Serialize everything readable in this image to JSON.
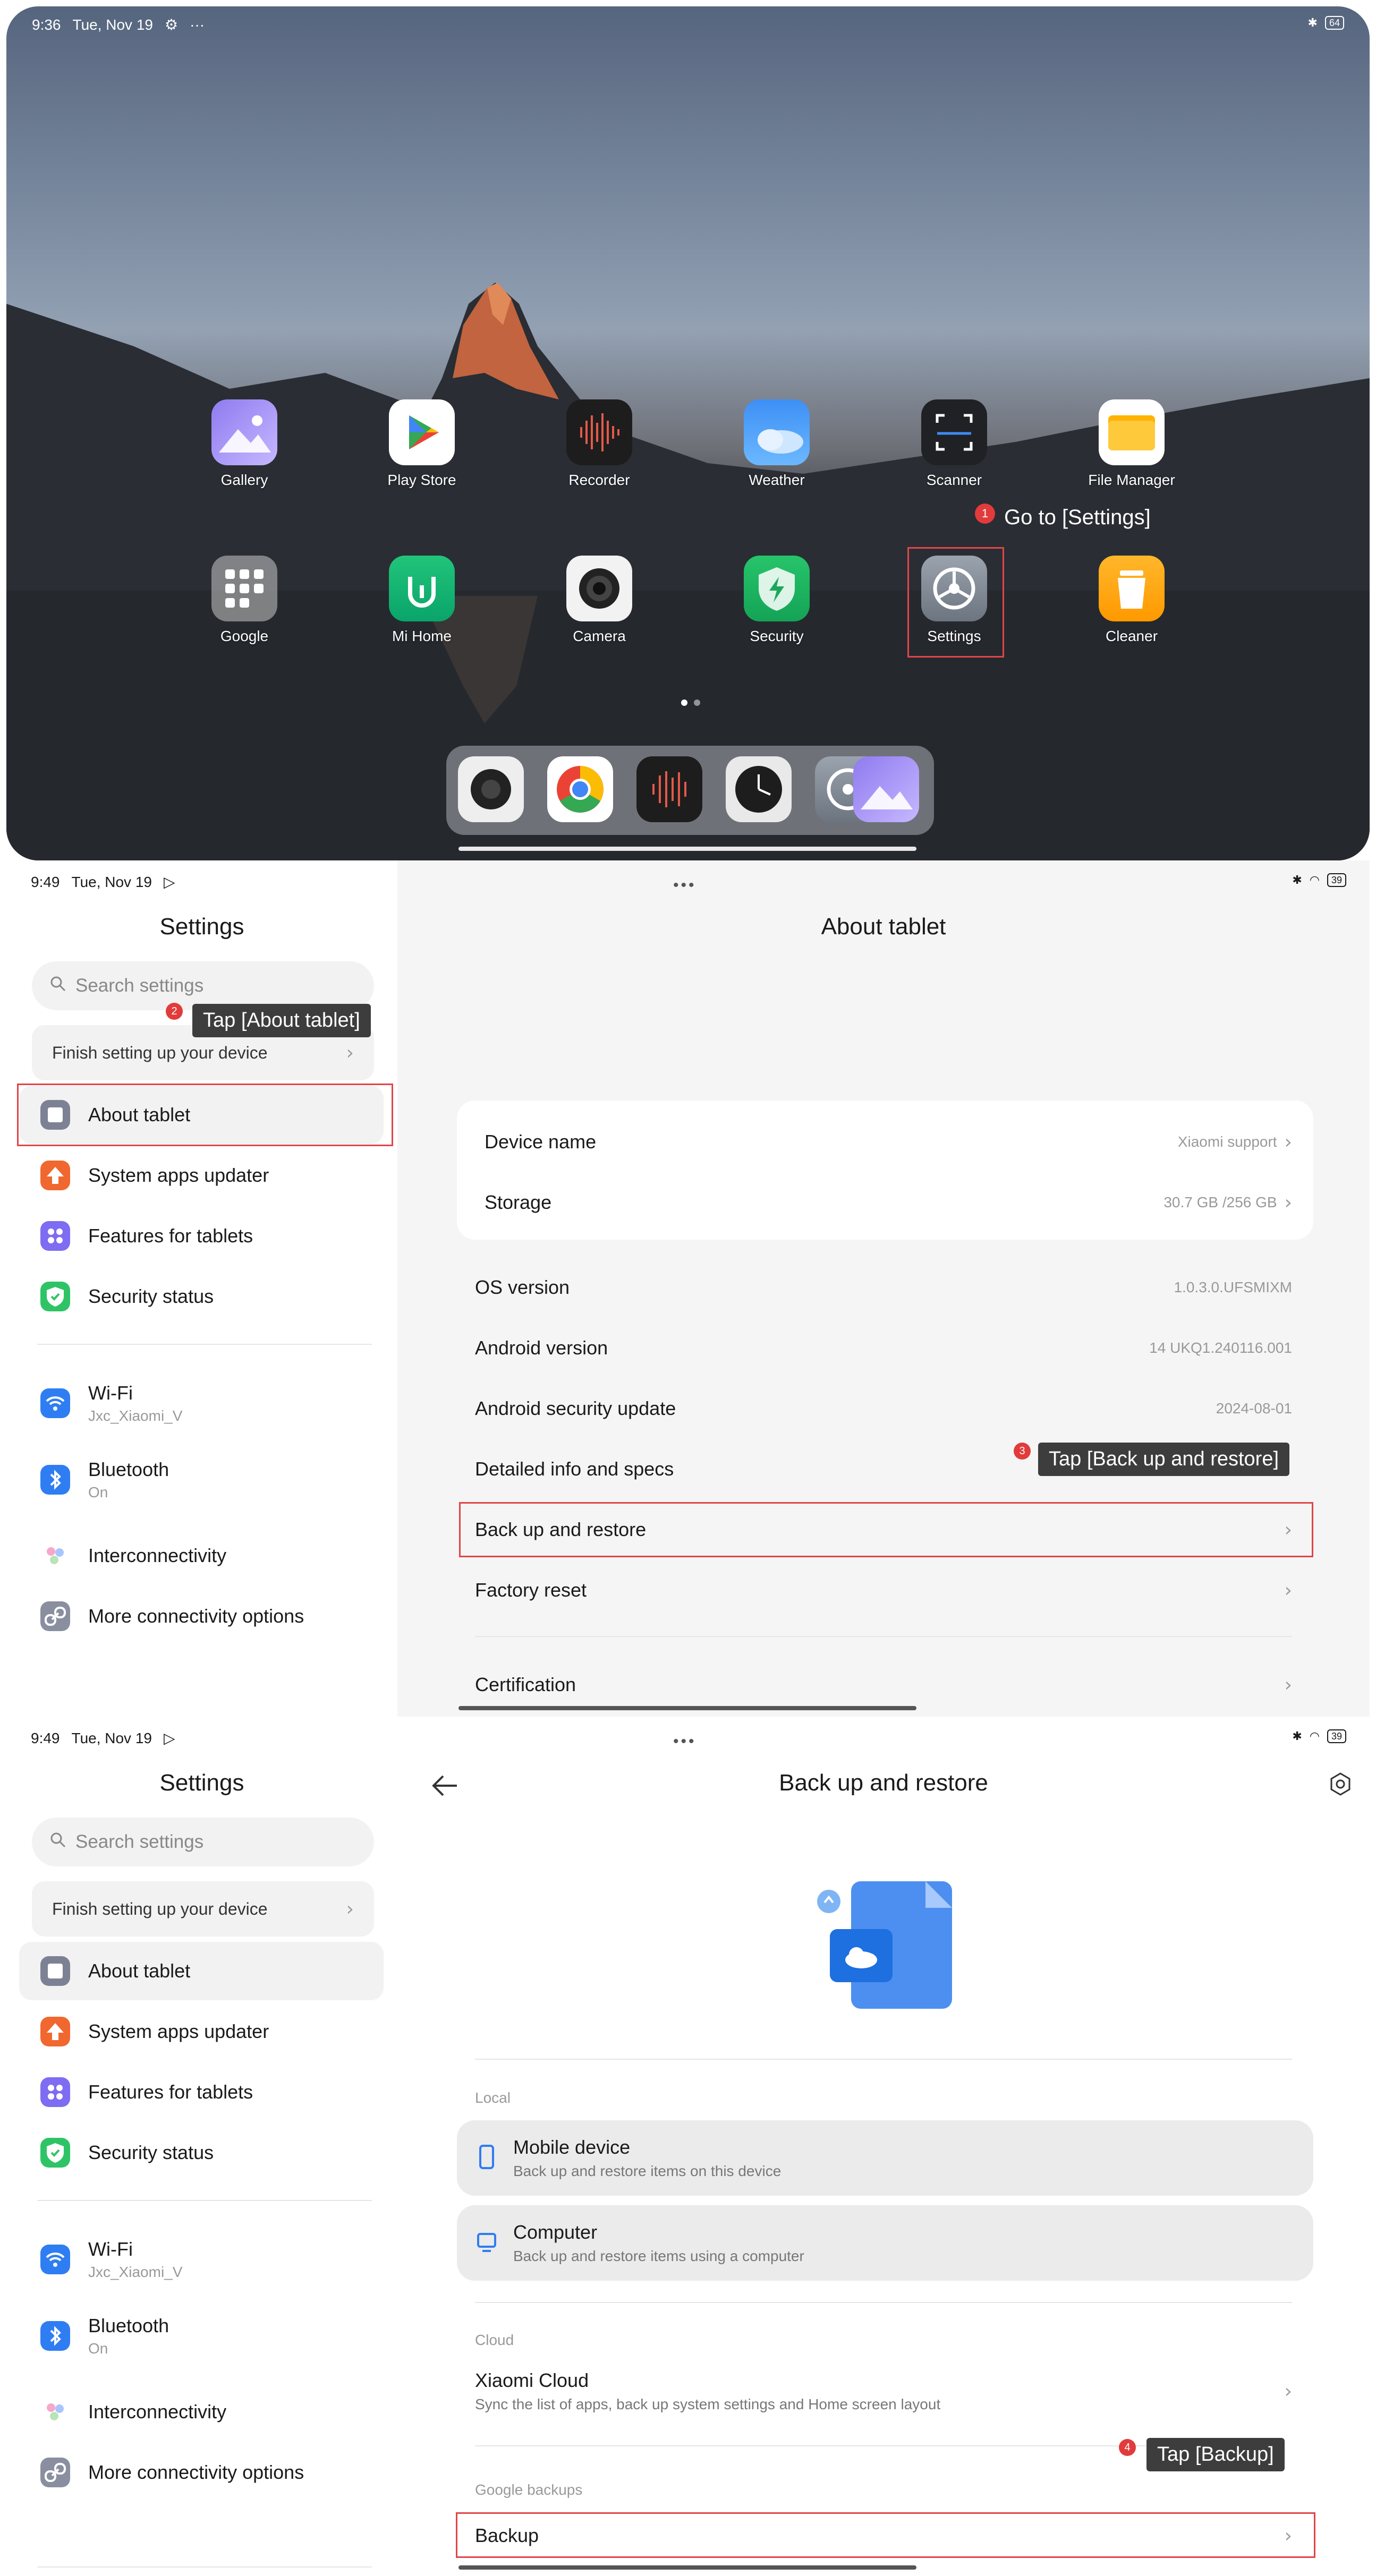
{
  "home": {
    "status_time": "9:36",
    "status_date": "Tue, Nov 19",
    "battery": "64",
    "apps_row1": [
      "Gallery",
      "Play Store",
      "Recorder",
      "Weather",
      "Scanner",
      "File Manager"
    ],
    "apps_row2": [
      "Google",
      "Mi Home",
      "Camera",
      "Security",
      "Settings",
      "Cleaner"
    ],
    "step1_badge": "1",
    "step1_tip": "Go to [Settings]"
  },
  "settings_panel": {
    "status_time": "9:49",
    "status_date": "Tue, Nov 19",
    "battery": "39",
    "left_title": "Settings",
    "search_placeholder": "Search settings",
    "finish_setup": "Finish setting up your device",
    "nav": {
      "about": "About tablet",
      "updater": "System apps updater",
      "features": "Features for tablets",
      "security": "Security status",
      "wifi": "Wi-Fi",
      "wifi_sub": "Jxc_Xiaomi_V",
      "bluetooth": "Bluetooth",
      "bluetooth_sub": "On",
      "interconnectivity": "Interconnectivity",
      "more": "More connectivity options"
    },
    "step2_badge": "2",
    "step2_tip": "Tap [About tablet]"
  },
  "about": {
    "title": "About tablet",
    "device_name_label": "Device name",
    "device_name_value": "Xiaomi support",
    "storage_label": "Storage",
    "storage_value": "30.7 GB /256 GB",
    "os_label": "OS version",
    "os_value": "1.0.3.0.UFSMIXM",
    "android_label": "Android version",
    "android_value": "14 UKQ1.240116.001",
    "security_update_label": "Android security update",
    "security_update_value": "2024-08-01",
    "detailed_label": "Detailed info and specs",
    "backup_label": "Back up and restore",
    "factory_label": "Factory reset",
    "cert_label": "Certification",
    "step3_badge": "3",
    "step3_tip": "Tap [Back up and restore]"
  },
  "backup": {
    "title": "Back up and restore",
    "local_label": "Local",
    "mobile_title": "Mobile device",
    "mobile_sub": "Back up and restore items on this device",
    "computer_title": "Computer",
    "computer_sub": "Back up and restore items using a computer",
    "cloud_label": "Cloud",
    "xiaomi_cloud_title": "Xiaomi Cloud",
    "xiaomi_cloud_sub": "Sync the list of apps, back up system settings and Home screen layout",
    "google_label": "Google backups",
    "backup_item": "Backup",
    "step4_badge": "4",
    "step4_tip": "Tap [Backup]"
  }
}
